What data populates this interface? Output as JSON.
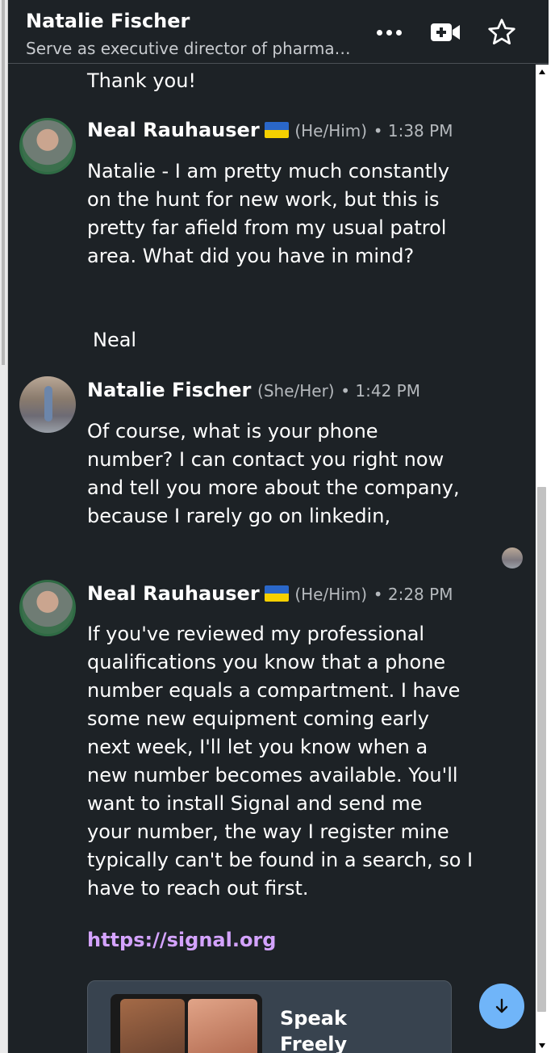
{
  "header": {
    "name": "Natalie Fischer",
    "subtitle": "Serve as executive director of pharma…",
    "icons": {
      "more": "more-dots-icon",
      "video": "video-call-icon",
      "star": "star-icon"
    }
  },
  "messages": [
    {
      "text": "Thank you!"
    },
    {
      "sender": "Neal Rauhauser",
      "flag": "🇺🇦",
      "pronouns": "(He/Him)",
      "time": "• 1:38 PM",
      "lines": [
        "Natalie - I am pretty much constantly",
        "on the hunt for new work, but this is",
        "pretty far afield from my usual patrol",
        "area. What did you have in mind?"
      ],
      "signature": "Neal"
    },
    {
      "sender": "Natalie Fischer",
      "pronouns": "(She/Her)",
      "time": "• 1:42 PM",
      "lines": [
        "Of course, what is your phone",
        "number? I can contact you right now",
        "and tell you more about the company,",
        "because I rarely go on linkedin,"
      ]
    },
    {
      "sender": "Neal Rauhauser",
      "flag": "🇺🇦",
      "pronouns": "(He/Him)",
      "time": "• 2:28 PM",
      "lines": [
        "If you've reviewed my professional",
        "qualifications you know that a phone",
        "number equals a compartment. I have",
        "some new equipment coming early",
        "next week, I'll let you know when a",
        "new number becomes available. You'll",
        "want to install Signal and send me",
        "your number, the way I register mine",
        "typically can't be found in a search, so I",
        "have to reach out first."
      ],
      "link": "https://signal.org",
      "preview": {
        "title_line1": "Speak",
        "title_line2": "Freely"
      }
    }
  ],
  "colors": {
    "panel_bg": "#1d2226",
    "link": "#d4a3ff",
    "fab": "#70b5f9",
    "flag_blue": "#2a67c9",
    "flag_yellow": "#f5d000"
  }
}
